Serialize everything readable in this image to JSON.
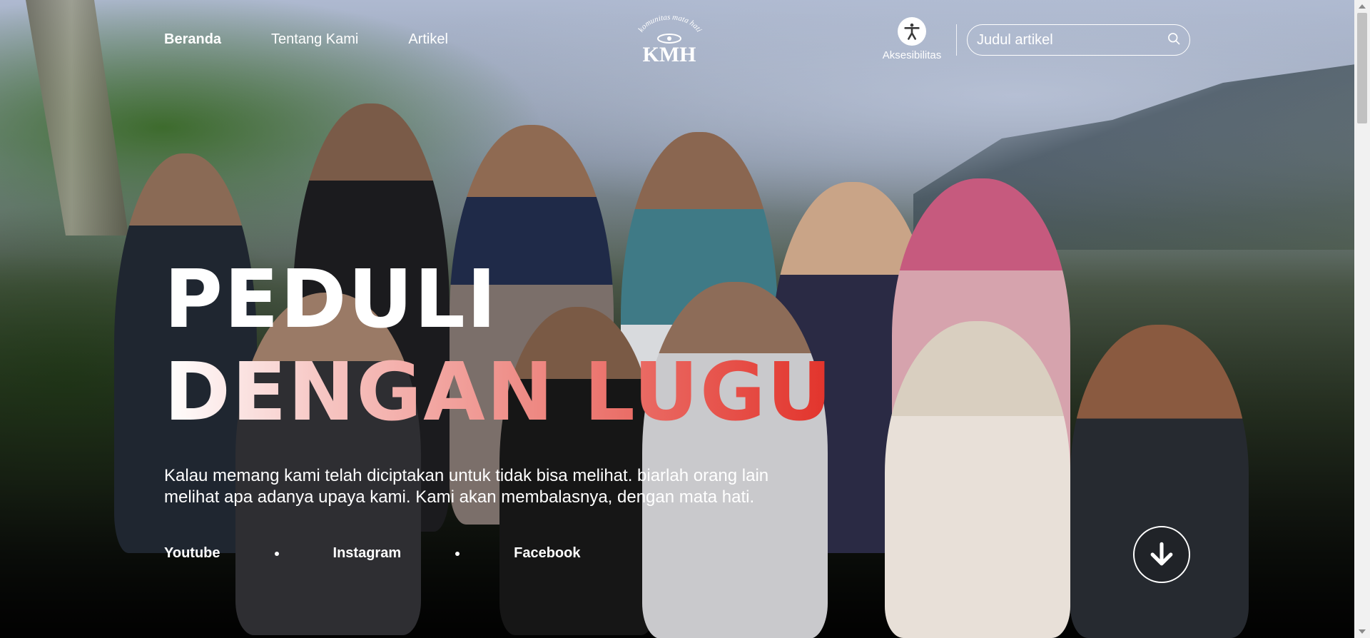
{
  "nav": {
    "items": [
      {
        "label": "Beranda",
        "active": true
      },
      {
        "label": "Tentang Kami",
        "active": false
      },
      {
        "label": "Artikel",
        "active": false
      }
    ]
  },
  "logo": {
    "arc_text": "komunitas mata hati",
    "initials": "KMH",
    "icon": "eye-logo-icon"
  },
  "accessibility": {
    "label": "Aksesibilitas",
    "icon": "accessibility-icon"
  },
  "search": {
    "placeholder": "Judul artikel",
    "icon": "search-icon"
  },
  "hero": {
    "line1": "PEDULI",
    "line2": "DENGAN LUGU",
    "tagline": "Kalau memang kami telah diciptakan untuk tidak bisa melihat. biarlah orang lain melihat apa adanya upaya kami. Kami akan membalasnya, dengan mata hati."
  },
  "social": {
    "links": [
      {
        "label": "Youtube"
      },
      {
        "label": "Instagram"
      },
      {
        "label": "Facebook"
      }
    ]
  },
  "scroll_down": {
    "icon": "arrow-down-icon"
  },
  "colors": {
    "accent_red": "#e2322a",
    "text": "#ffffff"
  }
}
